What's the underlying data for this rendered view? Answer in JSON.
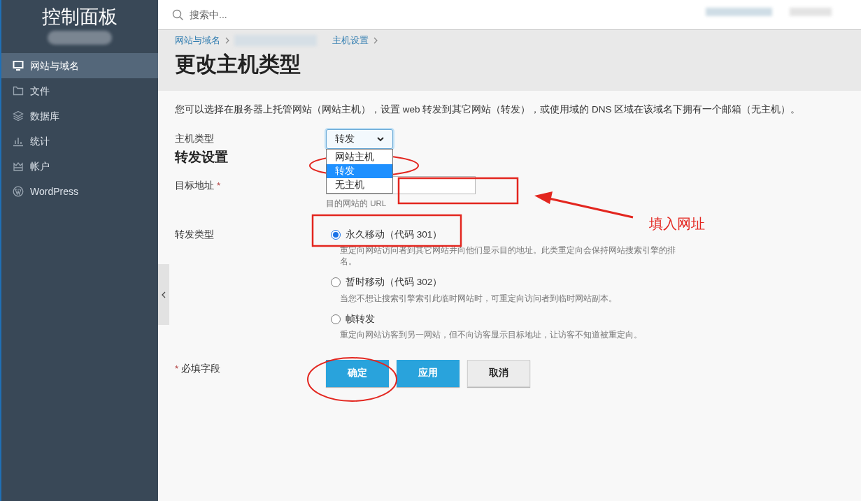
{
  "sidebar": {
    "title": "控制面板",
    "items": [
      {
        "label": "网站与域名",
        "selected": true
      },
      {
        "label": "文件",
        "selected": false
      },
      {
        "label": "数据库",
        "selected": false
      },
      {
        "label": "统计",
        "selected": false
      },
      {
        "label": "帐户",
        "selected": false
      },
      {
        "label": "WordPress",
        "selected": false
      }
    ]
  },
  "search": {
    "placeholder": "搜索中..."
  },
  "breadcrumbs": [
    "网站与域名",
    "主机设置"
  ],
  "page_title": "更改主机类型",
  "description": "您可以选择在服务器上托管网站（网站主机），设置 web 转发到其它网站（转发），或使用域的 DNS 区域在该域名下拥有一个邮箱（无主机）。",
  "host_type": {
    "label": "主机类型",
    "value": "转发",
    "expanded": true,
    "options": [
      {
        "label": "网站主机",
        "selected": false
      },
      {
        "label": "转发",
        "selected": true
      },
      {
        "label": "无主机",
        "selected": false
      }
    ]
  },
  "section_title": "转发设置",
  "target": {
    "label": "目标地址",
    "required_mark": "*",
    "hint": "目的网站的 URL"
  },
  "redirect_type": {
    "label": "转发类型",
    "options": [
      {
        "label": "永久移动（代码 301）",
        "description": "重定向网站访问者到其它网站并向他们显示目的地址。此类重定向会保持网站搜索引擎的排名。",
        "selected": true
      },
      {
        "label": "暂时移动（代码 302）",
        "description": "当您不想让搜索引擎索引此临时网站时，可重定向访问者到临时网站副本。",
        "selected": false
      },
      {
        "label": "帧转发",
        "description": "重定向网站访客到另一网站，但不向访客显示目标地址，让访客不知道被重定向。",
        "selected": false
      }
    ]
  },
  "required_note": {
    "mark": "*",
    "text": "必填字段"
  },
  "buttons": [
    {
      "label": "确定",
      "kind": "primary"
    },
    {
      "label": "应用",
      "kind": "primary"
    },
    {
      "label": "取消",
      "kind": "secondary"
    }
  ],
  "annotations": [
    {
      "kind": "ellipse"
    },
    {
      "kind": "rect"
    },
    {
      "kind": "arrow"
    },
    {
      "kind": "text",
      "text": "填入网址"
    },
    {
      "kind": "rect"
    },
    {
      "kind": "ellipse"
    }
  ]
}
